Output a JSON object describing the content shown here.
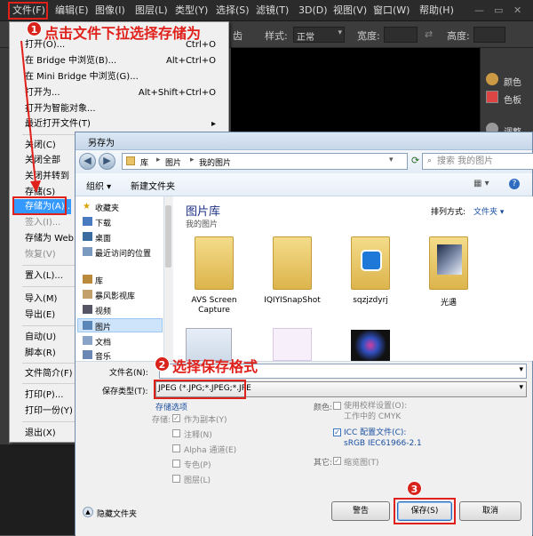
{
  "menubar": {
    "items": [
      "文件(F)",
      "编辑(E)",
      "图像(I)",
      "图层(L)",
      "类型(Y)",
      "选择(S)",
      "滤镜(T)",
      "3D(D)",
      "视图(V)",
      "窗口(W)",
      "帮助(H)"
    ]
  },
  "optbar": {
    "partial": "齿",
    "style_label": "样式:",
    "style_value": "正常",
    "width_label": "宽度:",
    "height_label": "高度:"
  },
  "right_panel": {
    "color": "颜色",
    "swatches": "色板",
    "adjust": "调整"
  },
  "menu": {
    "items": [
      {
        "label": "打开(O)...",
        "shortcut": "Ctrl+O"
      },
      {
        "label": "在 Bridge 中浏览(B)...",
        "shortcut": "Alt+Ctrl+O"
      },
      {
        "label": "在 Mini Bridge 中浏览(G)...",
        "shortcut": ""
      },
      {
        "label": "打开为...",
        "shortcut": "Alt+Shift+Ctrl+O"
      },
      {
        "label": "打开为智能对象...",
        "shortcut": ""
      },
      {
        "label": "最近打开文件(T)",
        "shortcut": "▸"
      },
      {
        "label": "关闭(C)",
        "shortcut": ""
      },
      {
        "label": "关闭全部",
        "shortcut": ""
      },
      {
        "label": "关闭并转到",
        "shortcut": ""
      },
      {
        "label": "存储(S)",
        "shortcut": ""
      },
      {
        "label": "存储为(A)...",
        "shortcut": ""
      },
      {
        "label": "签入(I)...",
        "shortcut": ""
      },
      {
        "label": "存储为 Web",
        "shortcut": ""
      },
      {
        "label": "恢复(V)",
        "shortcut": ""
      },
      {
        "label": "置入(L)...",
        "shortcut": ""
      },
      {
        "label": "导入(M)",
        "shortcut": ""
      },
      {
        "label": "导出(E)",
        "shortcut": ""
      },
      {
        "label": "自动(U)",
        "shortcut": ""
      },
      {
        "label": "脚本(R)",
        "shortcut": ""
      },
      {
        "label": "文件简介(F)",
        "shortcut": ""
      },
      {
        "label": "打印(P)...",
        "shortcut": ""
      },
      {
        "label": "打印一份(Y)",
        "shortcut": ""
      },
      {
        "label": "退出(X)",
        "shortcut": ""
      }
    ]
  },
  "annotations": {
    "step1": "点击文件下拉选择存储为",
    "step2": "选择保存格式",
    "n1": "1",
    "n2": "2",
    "n3": "3"
  },
  "dialog": {
    "title": "另存为",
    "path": [
      "库",
      "图片",
      "我的图片"
    ],
    "search_placeholder": "搜索 我的图片",
    "organize": "组织 ▾",
    "new_folder": "新建文件夹",
    "nav": [
      "收藏夹",
      "下载",
      "桌面",
      "最近访问的位置",
      "库",
      "暴风影视库",
      "视频",
      "图片",
      "文档",
      "音乐"
    ],
    "lib_title": "图片库",
    "lib_sub": "我的图片",
    "arrange_label": "排列方式:",
    "arrange_value": "文件夹 ▾",
    "folders": [
      "AVS Screen Capture",
      "IQIYISnapShot",
      "sqzjzdyrj",
      "光遇"
    ],
    "filename_label": "文件名(N):",
    "filename_value": "",
    "type_label": "保存类型(T):",
    "type_value": "JPEG (*.JPG;*.JPEG;*.JPE",
    "save_options": "存储选项",
    "save_label": "存储:",
    "opt_copy": "作为副本(Y)",
    "opt_notes": "注释(N)",
    "opt_alpha": "Alpha 通道(E)",
    "opt_spot": "专色(P)",
    "opt_layers": "图层(L)",
    "color_label": "颜色:",
    "proof": "使用校样设置(O): 工作中的 CMYK",
    "icc": "ICC 配置文件(C): sRGB IEC61966-2.1",
    "other_label": "其它:",
    "thumb": "缩览图(T)",
    "hide": "隐藏文件夹",
    "warn": "警告",
    "save": "保存(S)",
    "cancel": "取消"
  }
}
